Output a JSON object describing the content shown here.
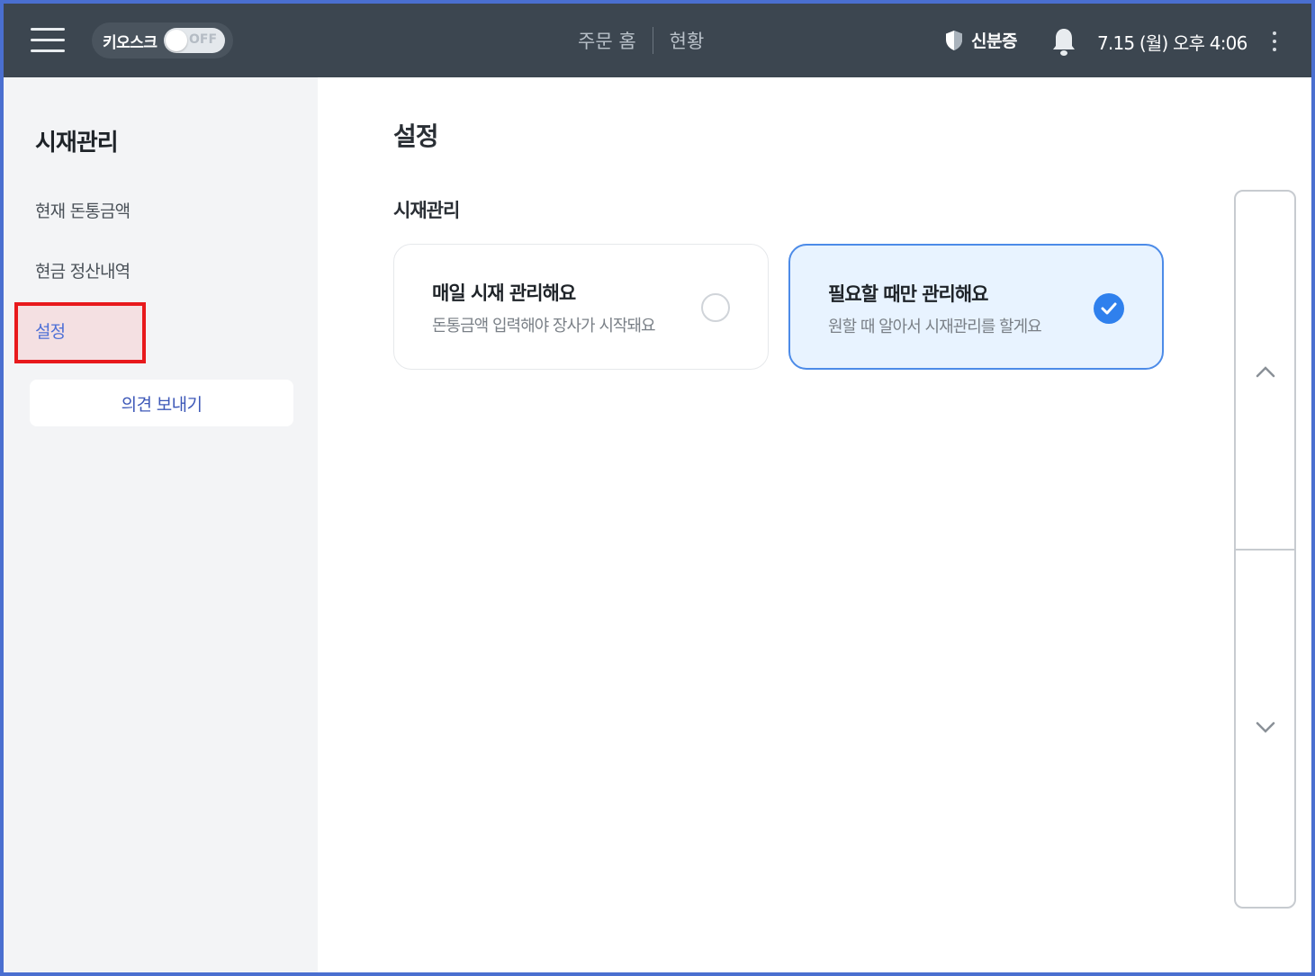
{
  "header": {
    "kiosk_label": "키오스크",
    "kiosk_toggle": "OFF",
    "nav": [
      "주문 홈",
      "현황"
    ],
    "id_card_label": "신분증",
    "datetime": "7.15 (월) 오후 4:06"
  },
  "sidebar": {
    "title": "시재관리",
    "items": [
      {
        "label": "현재 돈통금액"
      },
      {
        "label": "현금 정산내역"
      },
      {
        "label": "설정"
      }
    ],
    "feedback_label": "의견 보내기"
  },
  "main": {
    "title": "설정",
    "section_label": "시재관리",
    "options": [
      {
        "title": "매일 시재 관리해요",
        "desc": "돈통금액 입력해야 장사가 시작돼요",
        "selected": false
      },
      {
        "title": "필요할 때만 관리해요",
        "desc": "원할 때 알아서 시재관리를 할게요",
        "selected": true
      }
    ]
  },
  "colors": {
    "topbar": "#3c4650",
    "accent": "#2f80ed",
    "selected_bg": "#e8f3ff",
    "highlight_border": "#e8191c",
    "active_text": "#4d6fd6"
  }
}
